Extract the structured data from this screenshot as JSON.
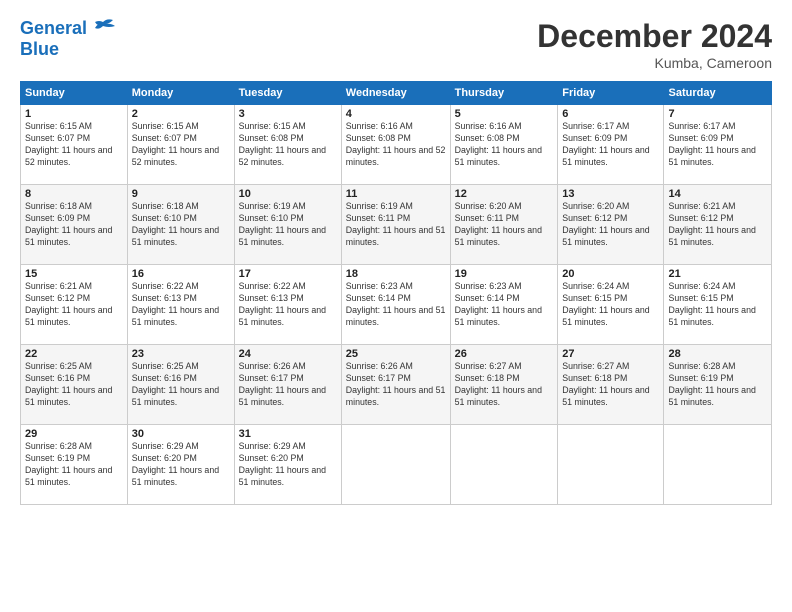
{
  "logo": {
    "line1": "General",
    "line2": "Blue"
  },
  "header": {
    "month": "December 2024",
    "location": "Kumba, Cameroon"
  },
  "weekdays": [
    "Sunday",
    "Monday",
    "Tuesday",
    "Wednesday",
    "Thursday",
    "Friday",
    "Saturday"
  ],
  "weeks": [
    [
      {
        "day": 1,
        "sunrise": "6:15 AM",
        "sunset": "6:07 PM",
        "daylight": "11 hours and 52 minutes."
      },
      {
        "day": 2,
        "sunrise": "6:15 AM",
        "sunset": "6:07 PM",
        "daylight": "11 hours and 52 minutes."
      },
      {
        "day": 3,
        "sunrise": "6:15 AM",
        "sunset": "6:08 PM",
        "daylight": "11 hours and 52 minutes."
      },
      {
        "day": 4,
        "sunrise": "6:16 AM",
        "sunset": "6:08 PM",
        "daylight": "11 hours and 52 minutes."
      },
      {
        "day": 5,
        "sunrise": "6:16 AM",
        "sunset": "6:08 PM",
        "daylight": "11 hours and 51 minutes."
      },
      {
        "day": 6,
        "sunrise": "6:17 AM",
        "sunset": "6:09 PM",
        "daylight": "11 hours and 51 minutes."
      },
      {
        "day": 7,
        "sunrise": "6:17 AM",
        "sunset": "6:09 PM",
        "daylight": "11 hours and 51 minutes."
      }
    ],
    [
      {
        "day": 8,
        "sunrise": "6:18 AM",
        "sunset": "6:09 PM",
        "daylight": "11 hours and 51 minutes."
      },
      {
        "day": 9,
        "sunrise": "6:18 AM",
        "sunset": "6:10 PM",
        "daylight": "11 hours and 51 minutes."
      },
      {
        "day": 10,
        "sunrise": "6:19 AM",
        "sunset": "6:10 PM",
        "daylight": "11 hours and 51 minutes."
      },
      {
        "day": 11,
        "sunrise": "6:19 AM",
        "sunset": "6:11 PM",
        "daylight": "11 hours and 51 minutes."
      },
      {
        "day": 12,
        "sunrise": "6:20 AM",
        "sunset": "6:11 PM",
        "daylight": "11 hours and 51 minutes."
      },
      {
        "day": 13,
        "sunrise": "6:20 AM",
        "sunset": "6:12 PM",
        "daylight": "11 hours and 51 minutes."
      },
      {
        "day": 14,
        "sunrise": "6:21 AM",
        "sunset": "6:12 PM",
        "daylight": "11 hours and 51 minutes."
      }
    ],
    [
      {
        "day": 15,
        "sunrise": "6:21 AM",
        "sunset": "6:12 PM",
        "daylight": "11 hours and 51 minutes."
      },
      {
        "day": 16,
        "sunrise": "6:22 AM",
        "sunset": "6:13 PM",
        "daylight": "11 hours and 51 minutes."
      },
      {
        "day": 17,
        "sunrise": "6:22 AM",
        "sunset": "6:13 PM",
        "daylight": "11 hours and 51 minutes."
      },
      {
        "day": 18,
        "sunrise": "6:23 AM",
        "sunset": "6:14 PM",
        "daylight": "11 hours and 51 minutes."
      },
      {
        "day": 19,
        "sunrise": "6:23 AM",
        "sunset": "6:14 PM",
        "daylight": "11 hours and 51 minutes."
      },
      {
        "day": 20,
        "sunrise": "6:24 AM",
        "sunset": "6:15 PM",
        "daylight": "11 hours and 51 minutes."
      },
      {
        "day": 21,
        "sunrise": "6:24 AM",
        "sunset": "6:15 PM",
        "daylight": "11 hours and 51 minutes."
      }
    ],
    [
      {
        "day": 22,
        "sunrise": "6:25 AM",
        "sunset": "6:16 PM",
        "daylight": "11 hours and 51 minutes."
      },
      {
        "day": 23,
        "sunrise": "6:25 AM",
        "sunset": "6:16 PM",
        "daylight": "11 hours and 51 minutes."
      },
      {
        "day": 24,
        "sunrise": "6:26 AM",
        "sunset": "6:17 PM",
        "daylight": "11 hours and 51 minutes."
      },
      {
        "day": 25,
        "sunrise": "6:26 AM",
        "sunset": "6:17 PM",
        "daylight": "11 hours and 51 minutes."
      },
      {
        "day": 26,
        "sunrise": "6:27 AM",
        "sunset": "6:18 PM",
        "daylight": "11 hours and 51 minutes."
      },
      {
        "day": 27,
        "sunrise": "6:27 AM",
        "sunset": "6:18 PM",
        "daylight": "11 hours and 51 minutes."
      },
      {
        "day": 28,
        "sunrise": "6:28 AM",
        "sunset": "6:19 PM",
        "daylight": "11 hours and 51 minutes."
      }
    ],
    [
      {
        "day": 29,
        "sunrise": "6:28 AM",
        "sunset": "6:19 PM",
        "daylight": "11 hours and 51 minutes."
      },
      {
        "day": 30,
        "sunrise": "6:29 AM",
        "sunset": "6:20 PM",
        "daylight": "11 hours and 51 minutes."
      },
      {
        "day": 31,
        "sunrise": "6:29 AM",
        "sunset": "6:20 PM",
        "daylight": "11 hours and 51 minutes."
      },
      null,
      null,
      null,
      null
    ]
  ]
}
